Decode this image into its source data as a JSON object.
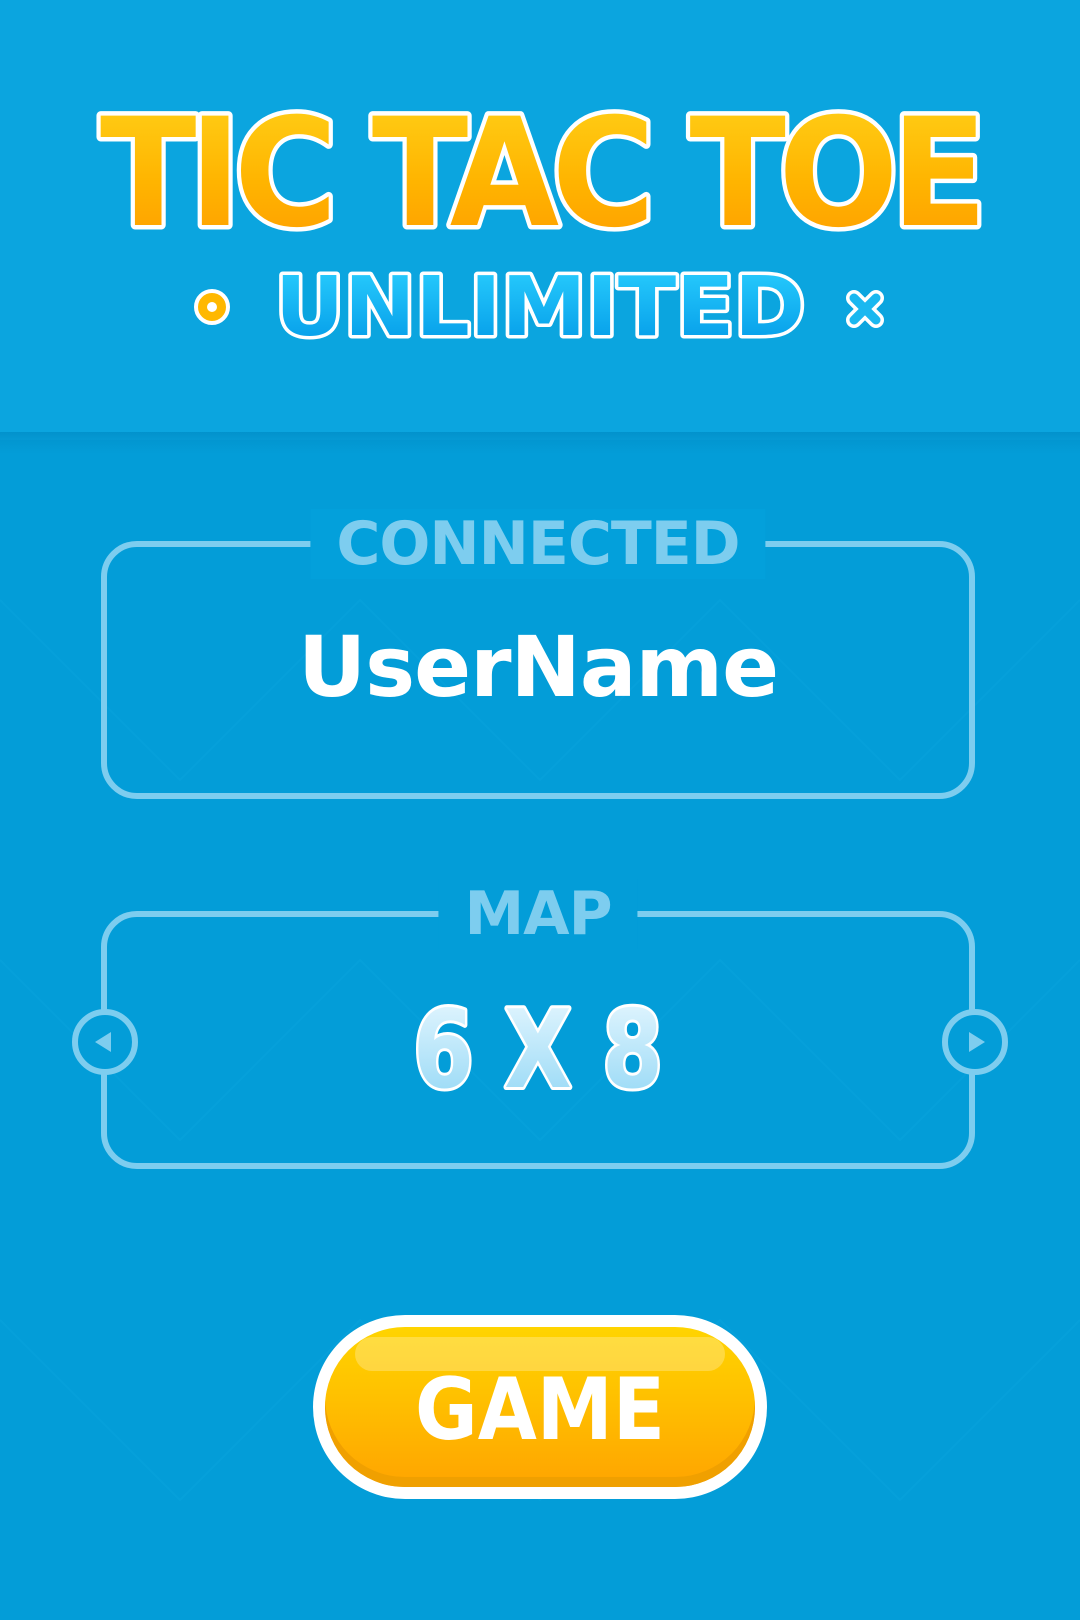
{
  "title": {
    "main": "TIC TAC TOE",
    "sub": "UNLIMITED",
    "icons": [
      "circle-icon",
      "cross-icon"
    ]
  },
  "connected": {
    "legend": "CONNECTED",
    "username": "UserName"
  },
  "map": {
    "legend": "MAP",
    "value": "6 X 8",
    "prev_icon": "chevron-left-icon",
    "next_icon": "chevron-right-icon"
  },
  "game_button": {
    "label": "GAME"
  },
  "colors": {
    "background": "#039dd8",
    "title_fill": "#ffb000",
    "subtitle_fill": "#00b4f0",
    "panel_stroke": "#7dcdef",
    "button_fill": "#ffc000"
  }
}
